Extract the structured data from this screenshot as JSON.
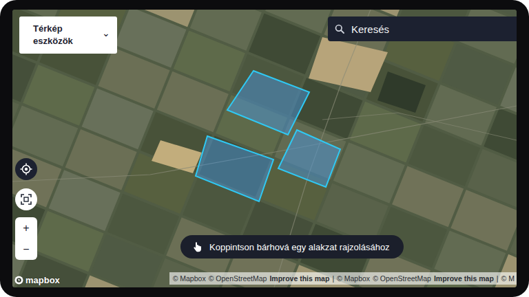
{
  "tools_menu": {
    "label": "Térkép eszközök",
    "chevron": "⌄"
  },
  "search": {
    "placeholder": "Keresés"
  },
  "controls": {
    "zoom_in": "+",
    "zoom_out": "−"
  },
  "fields": [
    {
      "highlighted": true
    },
    {
      "highlighted": true
    },
    {
      "highlighted": true
    }
  ],
  "hint": {
    "text": "Koppintson bárhová egy alakzat rajzolásához"
  },
  "logo": {
    "text": "mapbox"
  },
  "attribution": [
    {
      "text": "© Mapbox",
      "bold": false
    },
    {
      "text": "© OpenStreetMap",
      "bold": false
    },
    {
      "text": "Improve this map",
      "bold": true
    },
    {
      "text": "|",
      "bold": false
    },
    {
      "text": "© Mapbox",
      "bold": false
    },
    {
      "text": "© OpenStreetMap",
      "bold": false
    },
    {
      "text": "Improve this map",
      "bold": true
    },
    {
      "text": "|",
      "bold": false
    },
    {
      "text": "© M",
      "bold": false
    }
  ]
}
